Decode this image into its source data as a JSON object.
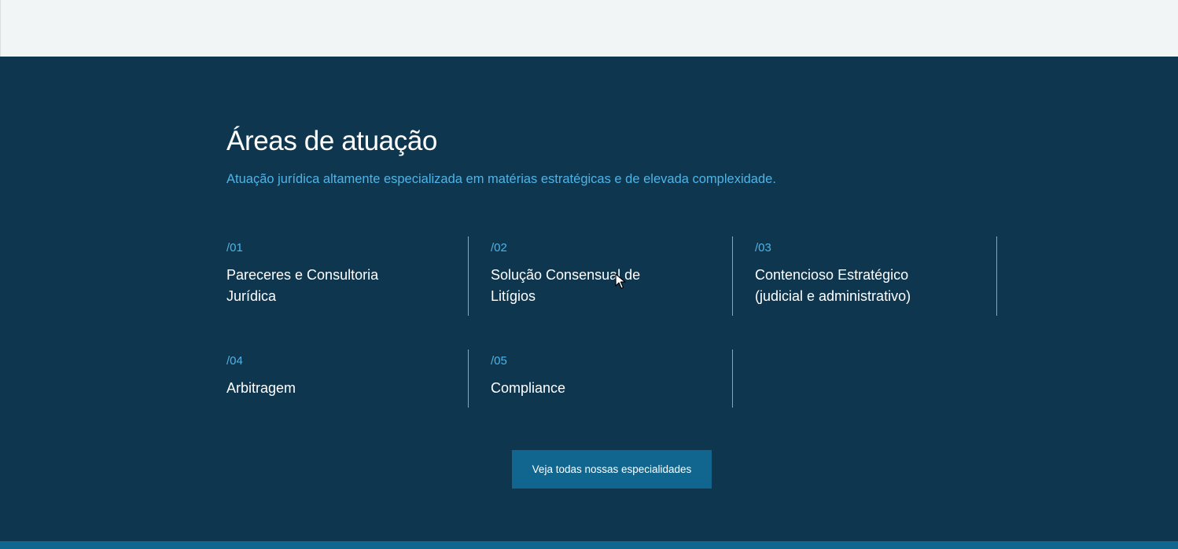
{
  "section": {
    "title": "Áreas de atuação",
    "subtitle": "Atuação jurídica altamente especializada em matérias estratégicas e de elevada complexidade."
  },
  "areas": [
    {
      "num": "/01",
      "name": "Pareceres e Consultoria Jurídica"
    },
    {
      "num": "/02",
      "name": "Solução Consensual de Litígios"
    },
    {
      "num": "/03",
      "name": "Contencioso Estratégico (judicial e administrativo)"
    },
    {
      "num": "/04",
      "name": "Arbitragem"
    },
    {
      "num": "/05",
      "name": "Compliance"
    }
  ],
  "cta": {
    "label": "Veja todas nossas especialidades"
  },
  "colors": {
    "background": "#0e374f",
    "accent": "#4fb3e6",
    "button": "#10668f",
    "top_band": "#f2f5f6"
  },
  "icons": {
    "cursor": "mouse-pointer-icon"
  }
}
